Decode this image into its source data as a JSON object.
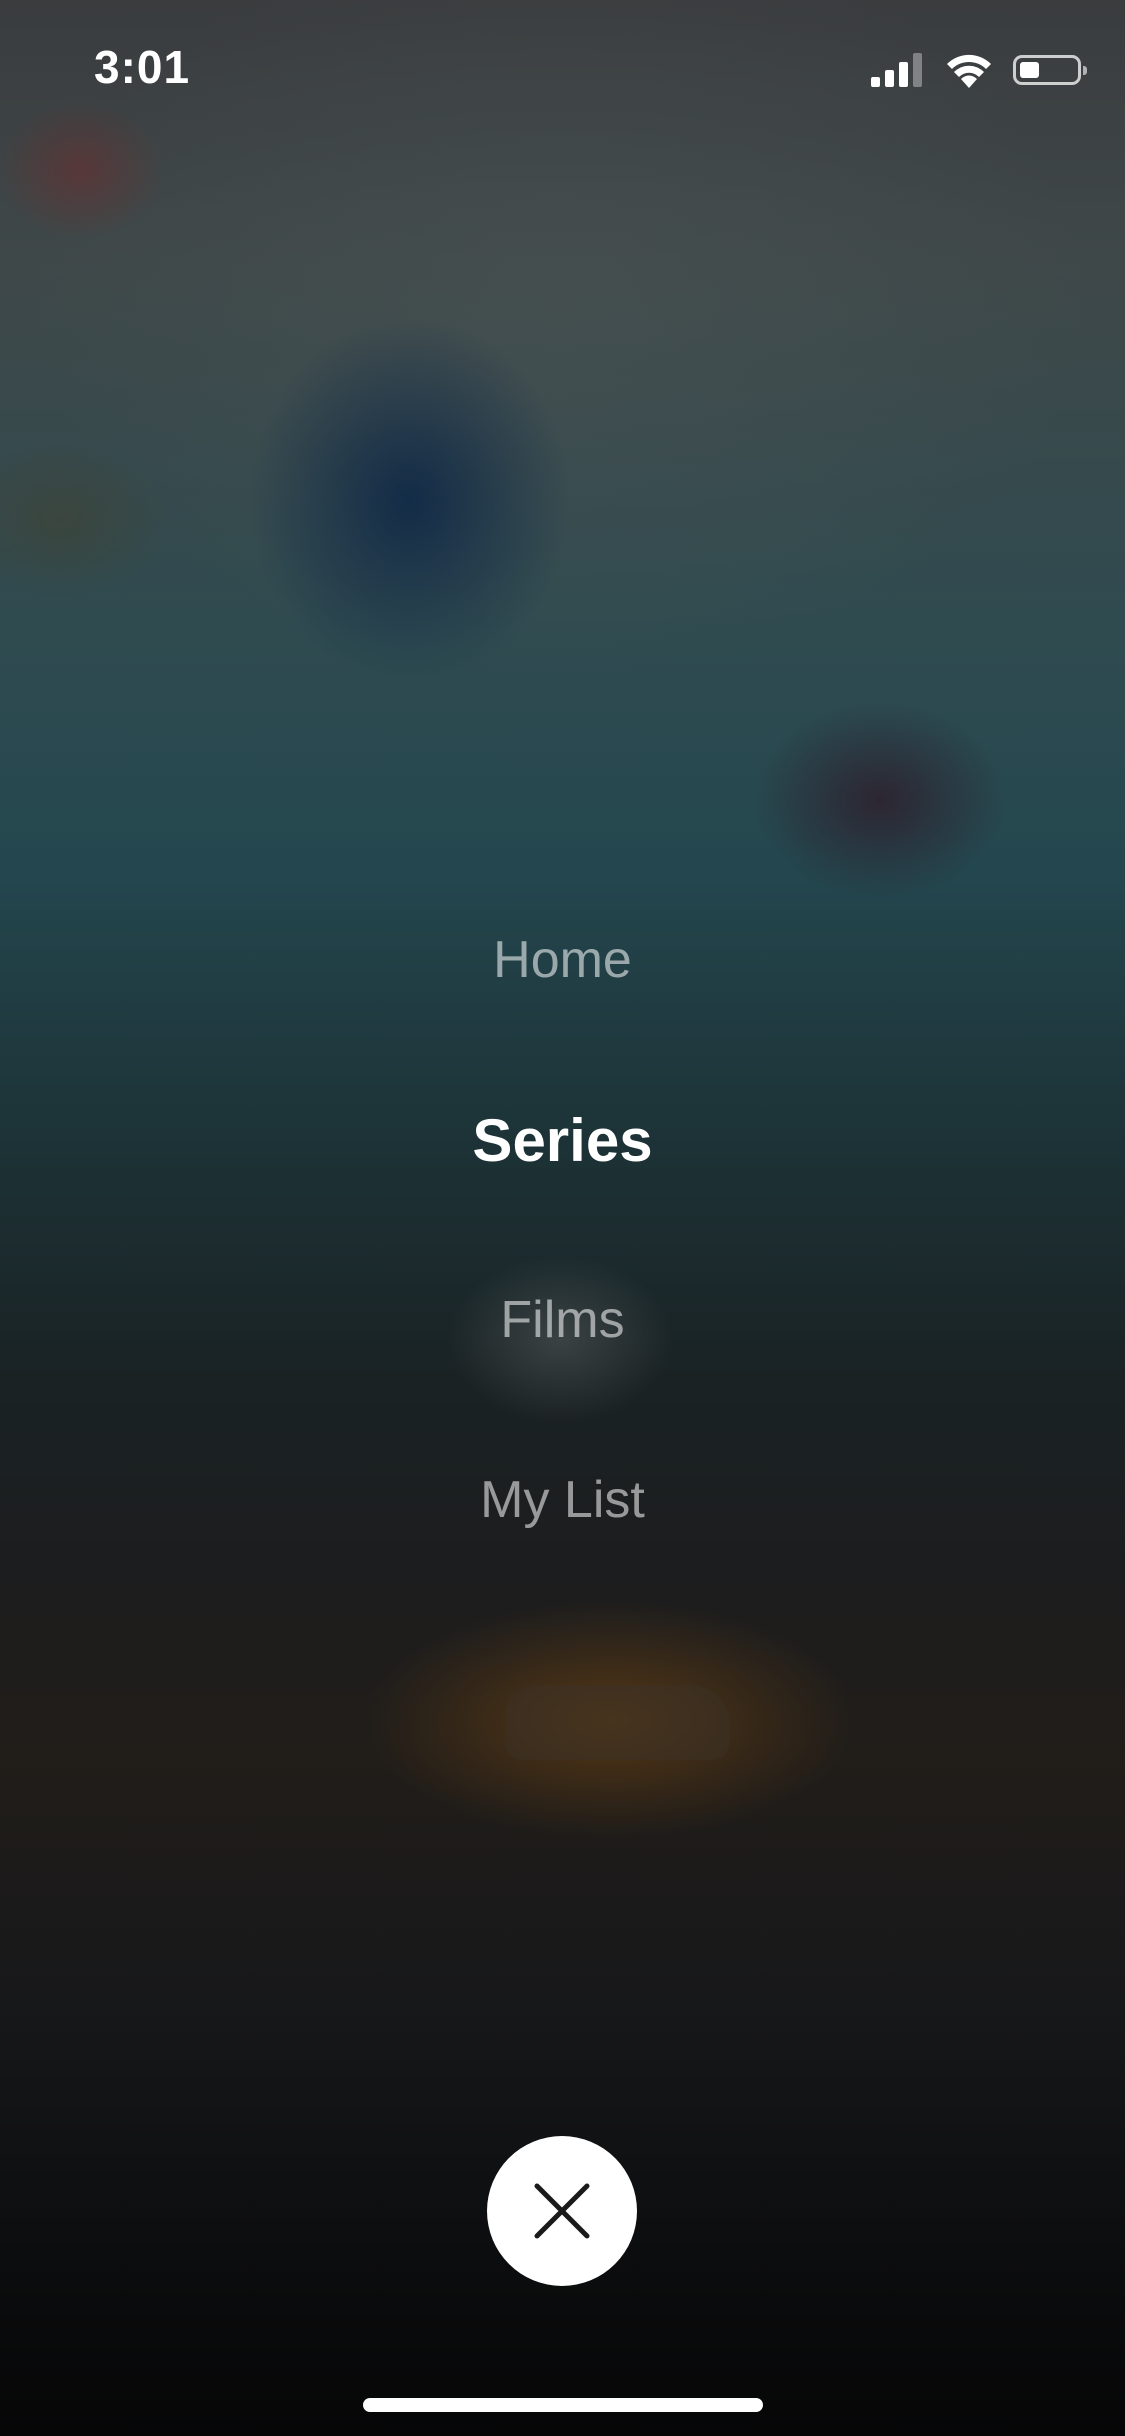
{
  "status_bar": {
    "time": "3:01",
    "icons": [
      "cellular-signal-icon",
      "wifi-icon",
      "battery-icon"
    ],
    "battery_level": 0.35
  },
  "menu": {
    "items": [
      {
        "label": "Home",
        "selected": false
      },
      {
        "label": "Series",
        "selected": true
      },
      {
        "label": "Films",
        "selected": false
      },
      {
        "label": "My List",
        "selected": false
      }
    ]
  },
  "close_button": {
    "icon": "close-icon",
    "background": "#ffffff",
    "icon_color": "#1a1a1a"
  },
  "colors": {
    "selected_text": "#ffffff",
    "unselected_text": "rgba(255,255,255,0.55)"
  }
}
